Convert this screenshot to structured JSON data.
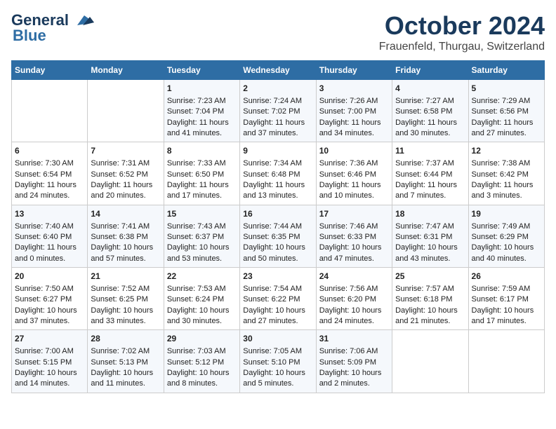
{
  "header": {
    "logo_line1": "General",
    "logo_line2": "Blue",
    "month_title": "October 2024",
    "subtitle": "Frauenfeld, Thurgau, Switzerland"
  },
  "weekdays": [
    "Sunday",
    "Monday",
    "Tuesday",
    "Wednesday",
    "Thursday",
    "Friday",
    "Saturday"
  ],
  "weeks": [
    [
      {
        "day": "",
        "sunrise": "",
        "sunset": "",
        "daylight": ""
      },
      {
        "day": "",
        "sunrise": "",
        "sunset": "",
        "daylight": ""
      },
      {
        "day": "1",
        "sunrise": "Sunrise: 7:23 AM",
        "sunset": "Sunset: 7:04 PM",
        "daylight": "Daylight: 11 hours and 41 minutes."
      },
      {
        "day": "2",
        "sunrise": "Sunrise: 7:24 AM",
        "sunset": "Sunset: 7:02 PM",
        "daylight": "Daylight: 11 hours and 37 minutes."
      },
      {
        "day": "3",
        "sunrise": "Sunrise: 7:26 AM",
        "sunset": "Sunset: 7:00 PM",
        "daylight": "Daylight: 11 hours and 34 minutes."
      },
      {
        "day": "4",
        "sunrise": "Sunrise: 7:27 AM",
        "sunset": "Sunset: 6:58 PM",
        "daylight": "Daylight: 11 hours and 30 minutes."
      },
      {
        "day": "5",
        "sunrise": "Sunrise: 7:29 AM",
        "sunset": "Sunset: 6:56 PM",
        "daylight": "Daylight: 11 hours and 27 minutes."
      }
    ],
    [
      {
        "day": "6",
        "sunrise": "Sunrise: 7:30 AM",
        "sunset": "Sunset: 6:54 PM",
        "daylight": "Daylight: 11 hours and 24 minutes."
      },
      {
        "day": "7",
        "sunrise": "Sunrise: 7:31 AM",
        "sunset": "Sunset: 6:52 PM",
        "daylight": "Daylight: 11 hours and 20 minutes."
      },
      {
        "day": "8",
        "sunrise": "Sunrise: 7:33 AM",
        "sunset": "Sunset: 6:50 PM",
        "daylight": "Daylight: 11 hours and 17 minutes."
      },
      {
        "day": "9",
        "sunrise": "Sunrise: 7:34 AM",
        "sunset": "Sunset: 6:48 PM",
        "daylight": "Daylight: 11 hours and 13 minutes."
      },
      {
        "day": "10",
        "sunrise": "Sunrise: 7:36 AM",
        "sunset": "Sunset: 6:46 PM",
        "daylight": "Daylight: 11 hours and 10 minutes."
      },
      {
        "day": "11",
        "sunrise": "Sunrise: 7:37 AM",
        "sunset": "Sunset: 6:44 PM",
        "daylight": "Daylight: 11 hours and 7 minutes."
      },
      {
        "day": "12",
        "sunrise": "Sunrise: 7:38 AM",
        "sunset": "Sunset: 6:42 PM",
        "daylight": "Daylight: 11 hours and 3 minutes."
      }
    ],
    [
      {
        "day": "13",
        "sunrise": "Sunrise: 7:40 AM",
        "sunset": "Sunset: 6:40 PM",
        "daylight": "Daylight: 11 hours and 0 minutes."
      },
      {
        "day": "14",
        "sunrise": "Sunrise: 7:41 AM",
        "sunset": "Sunset: 6:38 PM",
        "daylight": "Daylight: 10 hours and 57 minutes."
      },
      {
        "day": "15",
        "sunrise": "Sunrise: 7:43 AM",
        "sunset": "Sunset: 6:37 PM",
        "daylight": "Daylight: 10 hours and 53 minutes."
      },
      {
        "day": "16",
        "sunrise": "Sunrise: 7:44 AM",
        "sunset": "Sunset: 6:35 PM",
        "daylight": "Daylight: 10 hours and 50 minutes."
      },
      {
        "day": "17",
        "sunrise": "Sunrise: 7:46 AM",
        "sunset": "Sunset: 6:33 PM",
        "daylight": "Daylight: 10 hours and 47 minutes."
      },
      {
        "day": "18",
        "sunrise": "Sunrise: 7:47 AM",
        "sunset": "Sunset: 6:31 PM",
        "daylight": "Daylight: 10 hours and 43 minutes."
      },
      {
        "day": "19",
        "sunrise": "Sunrise: 7:49 AM",
        "sunset": "Sunset: 6:29 PM",
        "daylight": "Daylight: 10 hours and 40 minutes."
      }
    ],
    [
      {
        "day": "20",
        "sunrise": "Sunrise: 7:50 AM",
        "sunset": "Sunset: 6:27 PM",
        "daylight": "Daylight: 10 hours and 37 minutes."
      },
      {
        "day": "21",
        "sunrise": "Sunrise: 7:52 AM",
        "sunset": "Sunset: 6:25 PM",
        "daylight": "Daylight: 10 hours and 33 minutes."
      },
      {
        "day": "22",
        "sunrise": "Sunrise: 7:53 AM",
        "sunset": "Sunset: 6:24 PM",
        "daylight": "Daylight: 10 hours and 30 minutes."
      },
      {
        "day": "23",
        "sunrise": "Sunrise: 7:54 AM",
        "sunset": "Sunset: 6:22 PM",
        "daylight": "Daylight: 10 hours and 27 minutes."
      },
      {
        "day": "24",
        "sunrise": "Sunrise: 7:56 AM",
        "sunset": "Sunset: 6:20 PM",
        "daylight": "Daylight: 10 hours and 24 minutes."
      },
      {
        "day": "25",
        "sunrise": "Sunrise: 7:57 AM",
        "sunset": "Sunset: 6:18 PM",
        "daylight": "Daylight: 10 hours and 21 minutes."
      },
      {
        "day": "26",
        "sunrise": "Sunrise: 7:59 AM",
        "sunset": "Sunset: 6:17 PM",
        "daylight": "Daylight: 10 hours and 17 minutes."
      }
    ],
    [
      {
        "day": "27",
        "sunrise": "Sunrise: 7:00 AM",
        "sunset": "Sunset: 5:15 PM",
        "daylight": "Daylight: 10 hours and 14 minutes."
      },
      {
        "day": "28",
        "sunrise": "Sunrise: 7:02 AM",
        "sunset": "Sunset: 5:13 PM",
        "daylight": "Daylight: 10 hours and 11 minutes."
      },
      {
        "day": "29",
        "sunrise": "Sunrise: 7:03 AM",
        "sunset": "Sunset: 5:12 PM",
        "daylight": "Daylight: 10 hours and 8 minutes."
      },
      {
        "day": "30",
        "sunrise": "Sunrise: 7:05 AM",
        "sunset": "Sunset: 5:10 PM",
        "daylight": "Daylight: 10 hours and 5 minutes."
      },
      {
        "day": "31",
        "sunrise": "Sunrise: 7:06 AM",
        "sunset": "Sunset: 5:09 PM",
        "daylight": "Daylight: 10 hours and 2 minutes."
      },
      {
        "day": "",
        "sunrise": "",
        "sunset": "",
        "daylight": ""
      },
      {
        "day": "",
        "sunrise": "",
        "sunset": "",
        "daylight": ""
      }
    ]
  ]
}
